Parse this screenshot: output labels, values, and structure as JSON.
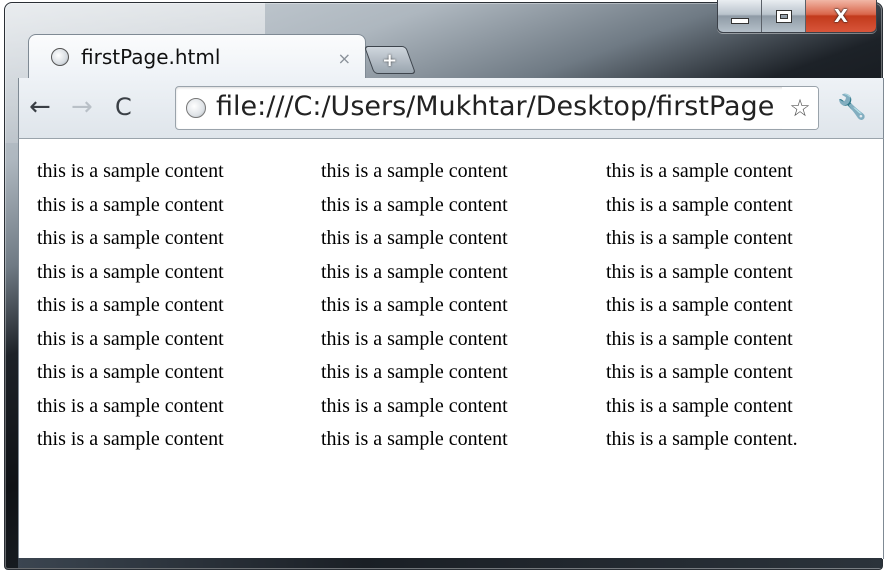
{
  "window": {
    "caption": {
      "minimize": "—",
      "maximize": "□",
      "close": "X"
    }
  },
  "tab": {
    "title": "firstPage.html",
    "close": "×",
    "favicon": "globe-icon"
  },
  "new_tab": {
    "label": "+"
  },
  "toolbar": {
    "back": "←",
    "forward": "→",
    "reload": "C",
    "url": "file:///C:/Users/Mukhtar/Desktop/firstPage",
    "star": "☆",
    "wrench": "🔧"
  },
  "content": {
    "columns": [
      [
        "this is a sample content",
        "this is a sample content",
        "this is a sample content",
        "this is a sample content",
        "this is a sample content",
        "this is a sample content",
        "this is a sample content",
        "this is a sample content",
        "this is a sample content"
      ],
      [
        "this is a sample content",
        "this is a sample content",
        "this is a sample content",
        "this is a sample content",
        "this is a sample content",
        "this is a sample content",
        "this is a sample content",
        "this is a sample content",
        "this is a sample content"
      ],
      [
        "this is a sample content",
        "this is a sample content",
        "this is a sample content",
        "this is a sample content",
        "this is a sample content",
        "this is a sample content",
        "this is a sample content",
        "this is a sample content",
        "this is a sample content."
      ]
    ]
  }
}
